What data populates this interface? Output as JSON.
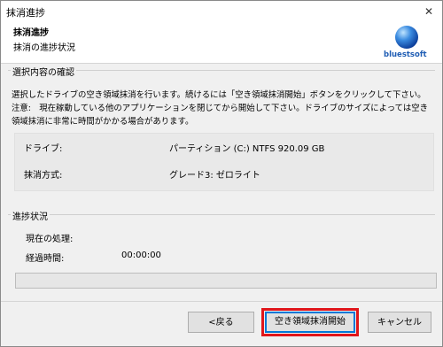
{
  "window": {
    "title": "抹消進捗",
    "close_glyph": "✕"
  },
  "header": {
    "title": "抹消進捗",
    "subtitle": "抹消の進捗状況",
    "logo_text": "bluestsoft"
  },
  "confirm": {
    "label": "選択内容の確認",
    "description": "選択したドライブの空き領域抹消を行います。続けるには「空き領域抹消開始」ボタンをクリックして下さい。 注意:　現在稼動している他のアプリケーションを閉じてから開始して下さい。ドライブのサイズによっては空き領域抹消に非常に時間がかかる場合があります。",
    "drive_label": "ドライブ:",
    "drive_value": "パーティション (C:) NTFS 920.09 GB",
    "method_label": "抹消方式:",
    "method_value": "グレード3: ゼロライト"
  },
  "progress": {
    "label": "進捗状況",
    "current_label": "現在の処理:",
    "current_value": "",
    "elapsed_label": "経過時間:",
    "elapsed_value": "00:00:00",
    "fraction": 0
  },
  "buttons": {
    "back": "<戻る",
    "start": "空き領域抹消開始",
    "cancel": "キャンセル"
  },
  "colors": {
    "accent": "#0078d7",
    "highlight": "#e0161b",
    "logo": "#1f5db4"
  }
}
